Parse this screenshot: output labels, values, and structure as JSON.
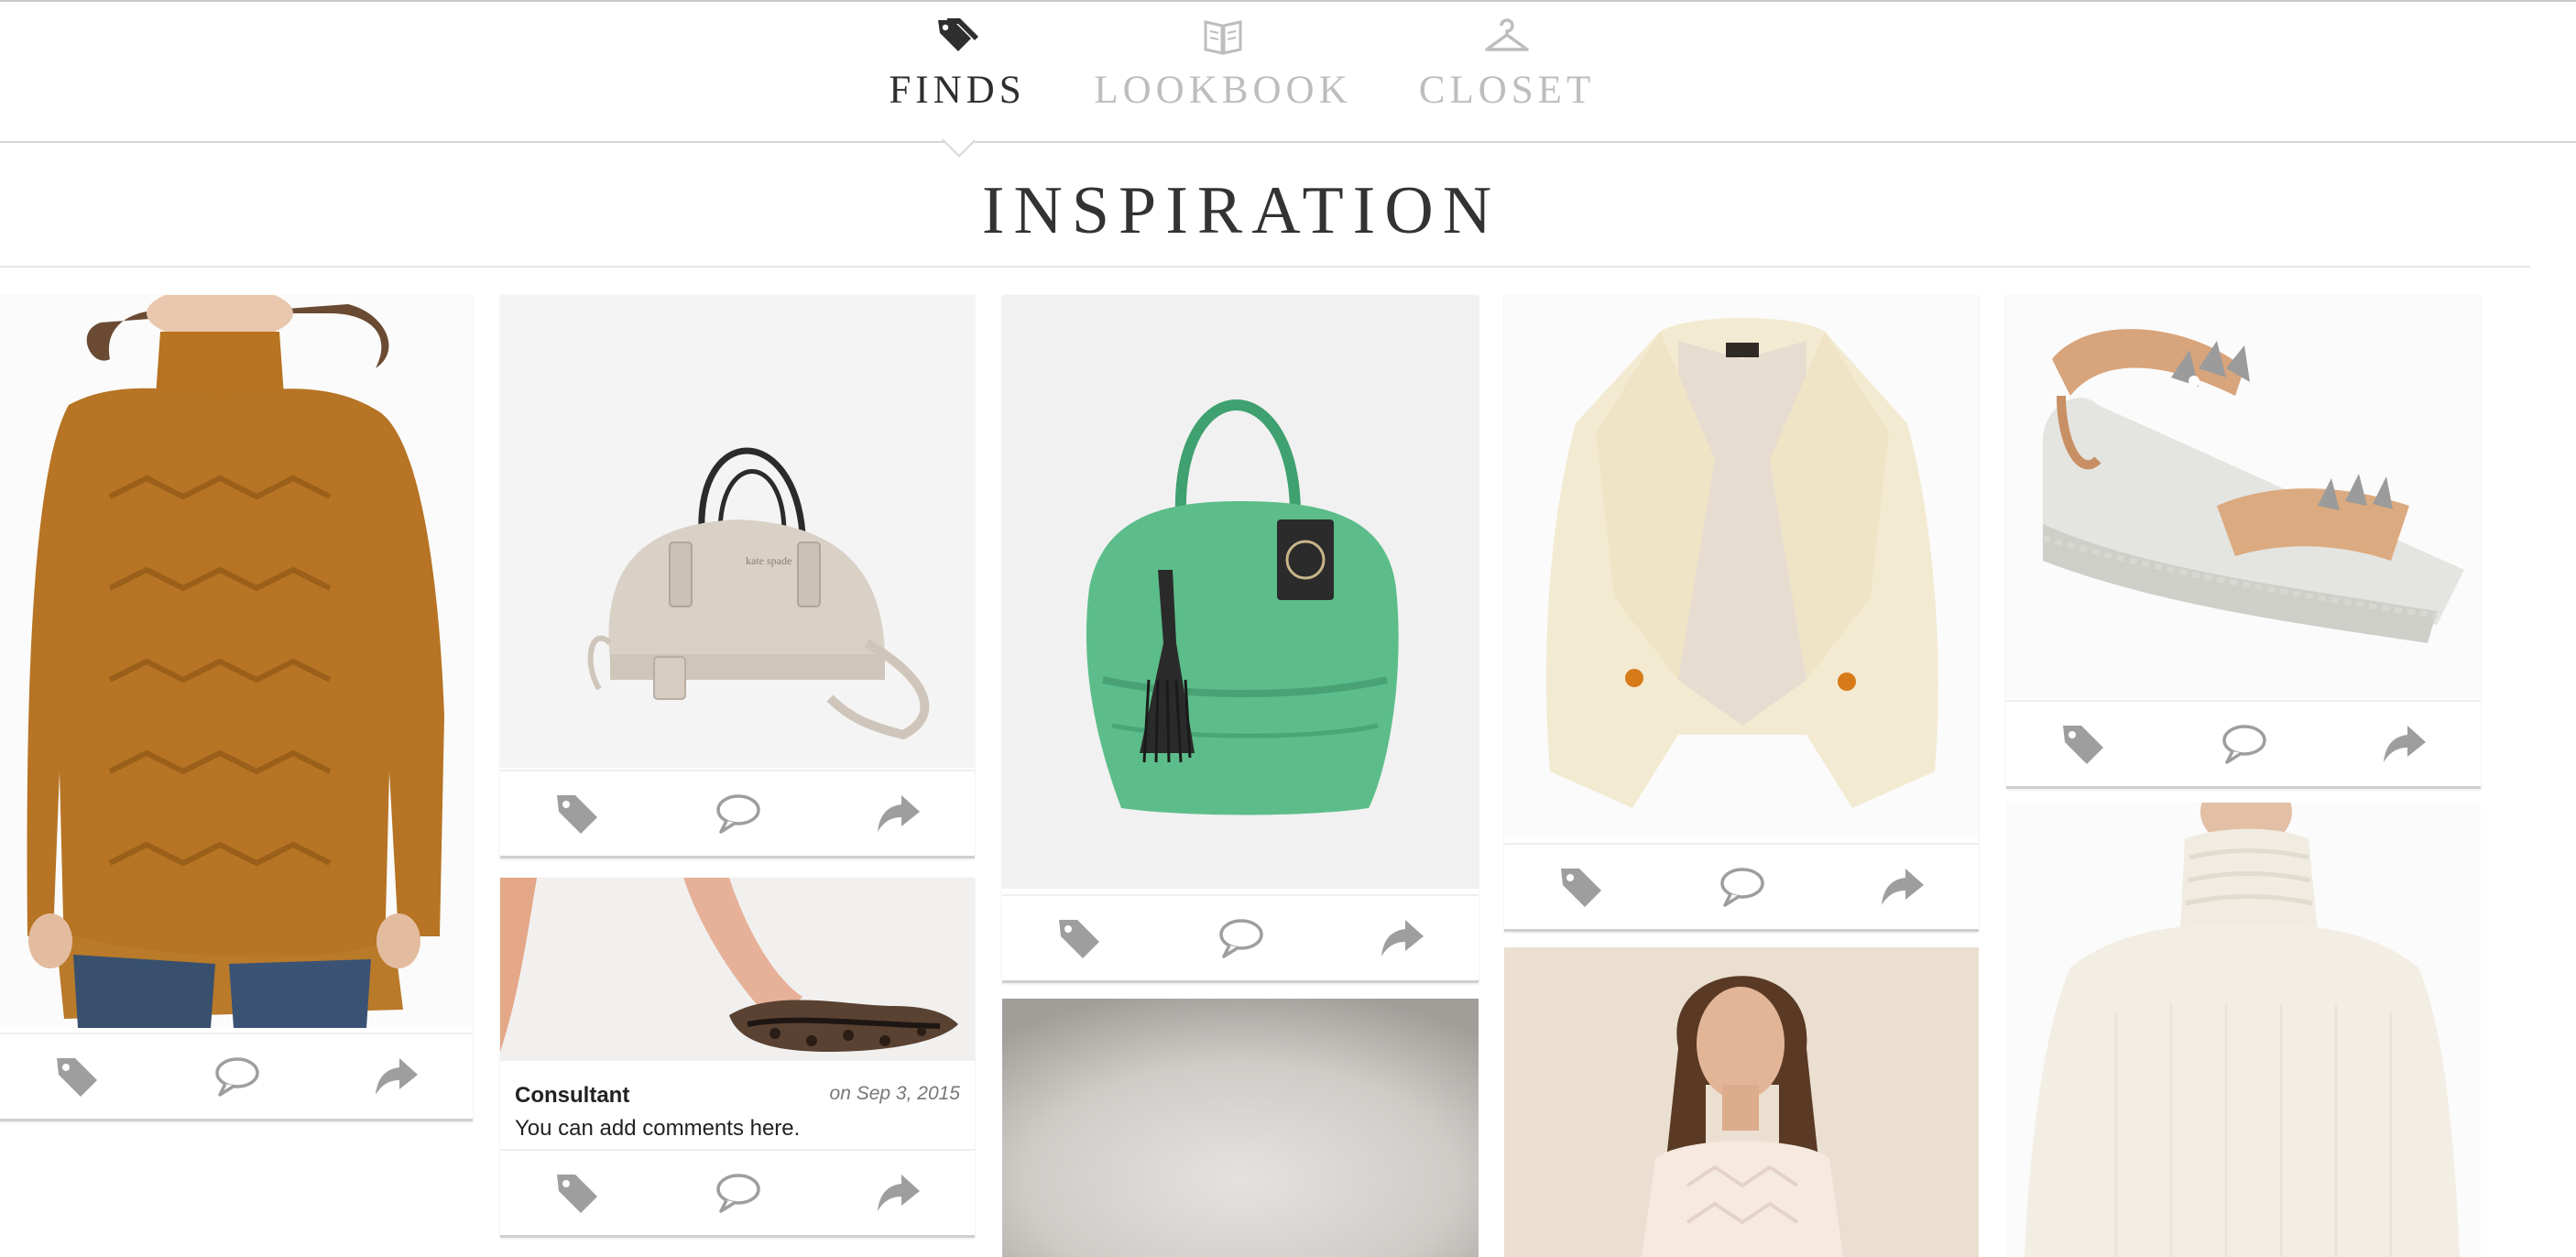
{
  "nav": {
    "items": [
      {
        "label": "FINDS",
        "icon": "price-tags-icon",
        "active": true
      },
      {
        "label": "LOOKBOOK",
        "icon": "open-book-icon",
        "active": false
      },
      {
        "label": "CLOSET",
        "icon": "hanger-icon",
        "active": false
      }
    ]
  },
  "heading": "INSPIRATION",
  "cards": [
    {
      "item": "mustard cable-knit turtleneck sweater",
      "actions": [
        "tag-icon",
        "comment-icon",
        "share-icon"
      ]
    },
    {
      "item": "taupe structured satchel handbag",
      "actions": [
        "tag-icon",
        "comment-icon",
        "share-icon"
      ]
    },
    {
      "item": "leopard print pointed flat",
      "comment": {
        "author": "Consultant",
        "date": "on Sep 3, 2015",
        "text": "You can add comments here."
      },
      "actions": [
        "tag-icon",
        "comment-icon",
        "share-icon"
      ]
    },
    {
      "item": "green leather tote with tassel",
      "actions": [
        "tag-icon",
        "comment-icon",
        "share-icon"
      ]
    },
    {
      "item": "grey photo backdrop"
    },
    {
      "item": "cream shearling coat",
      "actions": [
        "tag-icon",
        "comment-icon",
        "share-icon"
      ]
    },
    {
      "item": "model in blush textured top"
    },
    {
      "item": "studded wedge sandal",
      "actions": [
        "tag-icon",
        "comment-icon",
        "share-icon"
      ]
    },
    {
      "item": "ivory funnel-neck sweater"
    }
  ],
  "colors": {
    "active_nav": "#2e2e2e",
    "inactive_nav": "#bdbdbd",
    "icon_grey": "#9e9e9e",
    "divider": "#d6d6d6"
  }
}
